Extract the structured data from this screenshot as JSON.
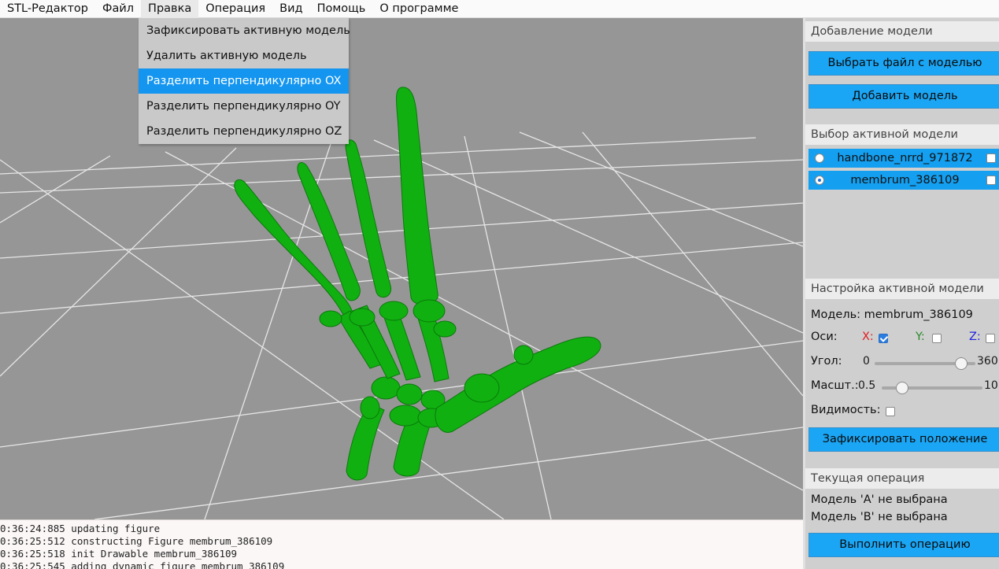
{
  "menubar": {
    "items": [
      "STL-Редактор",
      "Файл",
      "Правка",
      "Операция",
      "Вид",
      "Помощь",
      "О программе"
    ]
  },
  "dropdown": {
    "items": [
      "Зафиксировать активную модель",
      "Удалить активную модель",
      "Разделить перпендикулярно OX",
      "Разделить перпендикулярно OY",
      "Разделить перпендикулярно OZ"
    ],
    "highlighted_index": 2
  },
  "viewport": {
    "background": "#969696",
    "model_color": "#10b010",
    "model_icon": "hand-skeleton-model"
  },
  "log": {
    "lines": [
      "0:36:24:885 updating figure",
      "0:36:25:512 constructing Figure membrum_386109",
      "0:36:25:518 init Drawable membrum_386109",
      "0:36:25:545 adding dynamic figure membrum_386109"
    ]
  },
  "panel": {
    "add_model": {
      "title": "Добавление модели",
      "choose_file_button": "Выбрать файл с моделью",
      "add_button": "Добавить модель"
    },
    "select_model": {
      "title": "Выбор активной модели",
      "models": [
        {
          "name": "handbone_nrrd_971872",
          "selected": false,
          "checked": false
        },
        {
          "name": "membrum_386109",
          "selected": true,
          "checked": false
        }
      ]
    },
    "settings": {
      "title": "Настройка активной модели",
      "model_label": "Модель: membrum_386109",
      "axes_label": "Оси:",
      "axis_x": "X:",
      "axis_y": "Y:",
      "axis_z": "Z:",
      "axis_x_checked": true,
      "axis_y_checked": false,
      "axis_z_checked": false,
      "angle_label": "Угол:",
      "angle_min": "0",
      "angle_max": "360",
      "angle_level": 0.86,
      "scale_label": "Масшт.:",
      "scale_min": "0.5",
      "scale_max": "10",
      "scale_level": 0.2,
      "visibility_label": "Видимость:",
      "visibility_checked": false,
      "fix_button": "Зафиксировать положение"
    },
    "operation": {
      "title": "Текущая операция",
      "model_a": "Модель 'A' не выбрана",
      "model_b": "Модель 'B' не выбрана",
      "run_button": "Выполнить операцию"
    },
    "colors": {
      "accent": "#1aa6f5",
      "axis_x": "#e02020",
      "axis_y": "#2a8a2a",
      "axis_z": "#2020e0"
    }
  }
}
